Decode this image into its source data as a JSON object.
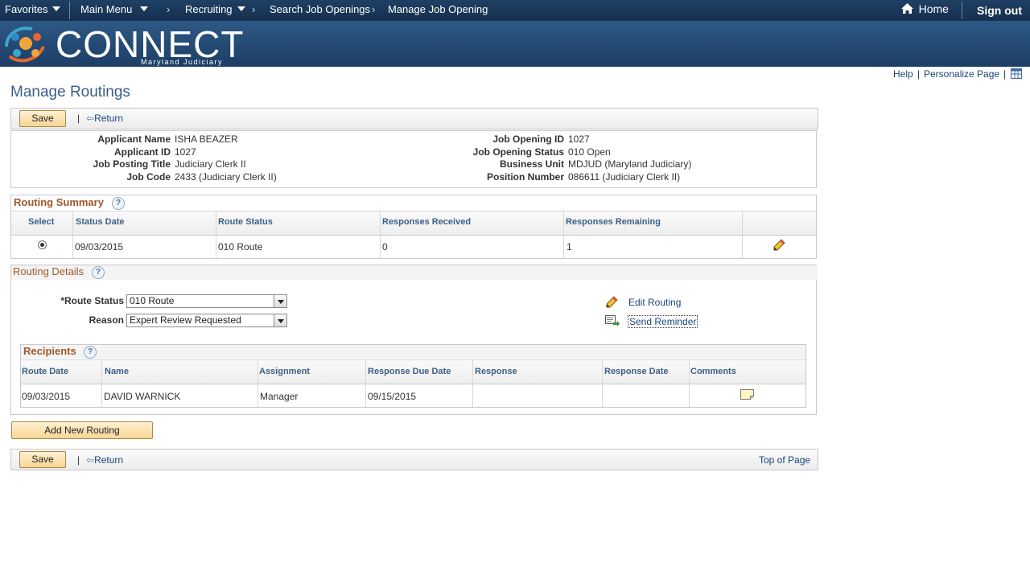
{
  "topnav": {
    "favorites": "Favorites",
    "main_menu": "Main Menu",
    "breadcrumbs": [
      "Recruiting",
      "Search Job Openings",
      "Manage Job Opening"
    ],
    "home": "Home",
    "sign_out": "Sign out"
  },
  "banner": {
    "brand": "CONNECT",
    "subtitle": "Maryland Judiciary"
  },
  "util": {
    "help": "Help",
    "personalize": "Personalize Page"
  },
  "page": {
    "title": "Manage Routings"
  },
  "toolbar": {
    "save": "Save",
    "separator": "|",
    "return": "Return",
    "top_of_page": "Top of Page"
  },
  "header": {
    "applicant_name": {
      "label": "Applicant Name",
      "value": "ISHA BEAZER"
    },
    "applicant_id": {
      "label": "Applicant ID",
      "value": "1027"
    },
    "job_posting_title": {
      "label": "Job Posting Title",
      "value": "Judiciary Clerk II"
    },
    "job_code": {
      "label": "Job Code",
      "value": "2433 (Judiciary Clerk II)"
    },
    "job_opening_id": {
      "label": "Job Opening ID",
      "value": "1027"
    },
    "job_opening_status": {
      "label": "Job Opening Status",
      "value": "010 Open"
    },
    "business_unit": {
      "label": "Business Unit",
      "value": "MDJUD (Maryland Judiciary)"
    },
    "position_number": {
      "label": "Position Number",
      "value": "086611 (Judiciary Clerk II)"
    }
  },
  "routing_summary": {
    "title": "Routing Summary",
    "columns": [
      "Select",
      "Status Date",
      "Route Status",
      "Responses Received",
      "Responses Remaining"
    ],
    "rows": [
      {
        "status_date": "09/03/2015",
        "route_status": "010 Route",
        "responses_received": "0",
        "responses_remaining": "1"
      }
    ]
  },
  "routing_details": {
    "title": "Routing Details",
    "route_status_label": "*Route Status",
    "route_status_value": "010 Route",
    "reason_label": "Reason",
    "reason_value": "Expert Review Requested",
    "edit_routing": "Edit Routing",
    "send_reminder": "Send Reminder"
  },
  "recipients": {
    "title": "Recipients",
    "columns": [
      "Route Date",
      "Name",
      "Assignment",
      "Response Due Date",
      "Response",
      "Response Date",
      "Comments"
    ],
    "rows": [
      {
        "route_date": "09/03/2015",
        "name": "DAVID WARNICK",
        "assignment": "Manager",
        "response_due_date": "09/15/2015",
        "response": "",
        "response_date": ""
      }
    ]
  },
  "add_new_routing": "Add New Routing",
  "colors": {
    "nav": "#1f3f63",
    "section_title": "#a1582c",
    "link": "#18457b",
    "button": "#f6d694"
  }
}
